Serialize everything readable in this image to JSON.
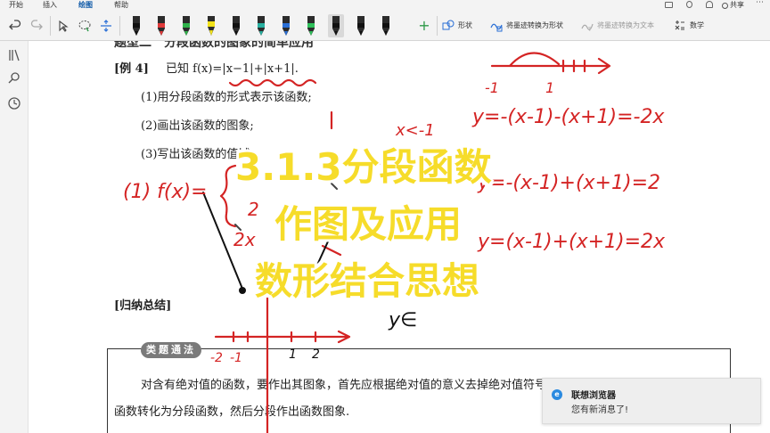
{
  "menu": {
    "items": [
      "开始",
      "插入",
      "绘图",
      "帮助"
    ],
    "share": "共享"
  },
  "ribbon": {
    "shape_label": "形状",
    "ink_to_shape": "将墨迹转换为形状",
    "ink_to_text": "将墨迹转换为文本",
    "math": "数学",
    "pens": [
      {
        "name": "pen-black",
        "color": "#111111"
      },
      {
        "name": "pen-red",
        "color": "#e03a3a"
      },
      {
        "name": "pen-green",
        "color": "#2fb24a"
      },
      {
        "name": "highlighter-yellow",
        "color": "#f2e21a"
      },
      {
        "name": "pen-black-2",
        "color": "#111111"
      },
      {
        "name": "pen-teal",
        "color": "#28b0a0"
      },
      {
        "name": "pen-blue",
        "color": "#2a6fd6"
      },
      {
        "name": "pen-lime",
        "color": "#2fc05a"
      },
      {
        "name": "pen-black-3",
        "color": "#111111"
      },
      {
        "name": "pen-black-4",
        "color": "#111111"
      },
      {
        "name": "pen-black-5",
        "color": "#111111"
      }
    ]
  },
  "document": {
    "section_heading": "题型二　分段函数的图象的简单应用",
    "example_label": "[例 4]",
    "example_text": "已知 f(x)=|x−1|+|x+1|.",
    "q1": "(1)用分段函数的形式表示该函数;",
    "q2": "(2)画出该函数的图象;",
    "q3": "(3)写出该函数的值域.",
    "summary_heading": "[归纳总结]",
    "box_tag": "类题通法",
    "box_line1": "对含有绝对值的函数，要作出其图象，首先应根据绝对值的意义去掉绝对值符号，将",
    "box_line2": "函数转化为分段函数，然后分段作出函数图象."
  },
  "handwriting": {
    "num_line": "0 —— ⌒ —— > X",
    "n_minus1": "-1",
    "n_1": "1",
    "case1_cond": "x<-1",
    "case1_eq": "y=-(x-1)-(x+1)=-2x",
    "f_label": "(1)  f(x)=",
    "case2_val": "2",
    "case2_eq": "y=-(x-1)+(x+1)=2",
    "case3_val": "2x",
    "case3_eq": "y=(x-1)+(x+1)=2x",
    "range_note": "y∈",
    "axis_m2": "-2",
    "axis_m1": "-1",
    "axis_1": "1",
    "axis_2": "2"
  },
  "overlay": {
    "line1": "3.1.3分段函数",
    "line2": "作图及应用",
    "line3": "数形结合思想"
  },
  "notification": {
    "title": "联想浏览器",
    "message": "您有新消息了!"
  }
}
